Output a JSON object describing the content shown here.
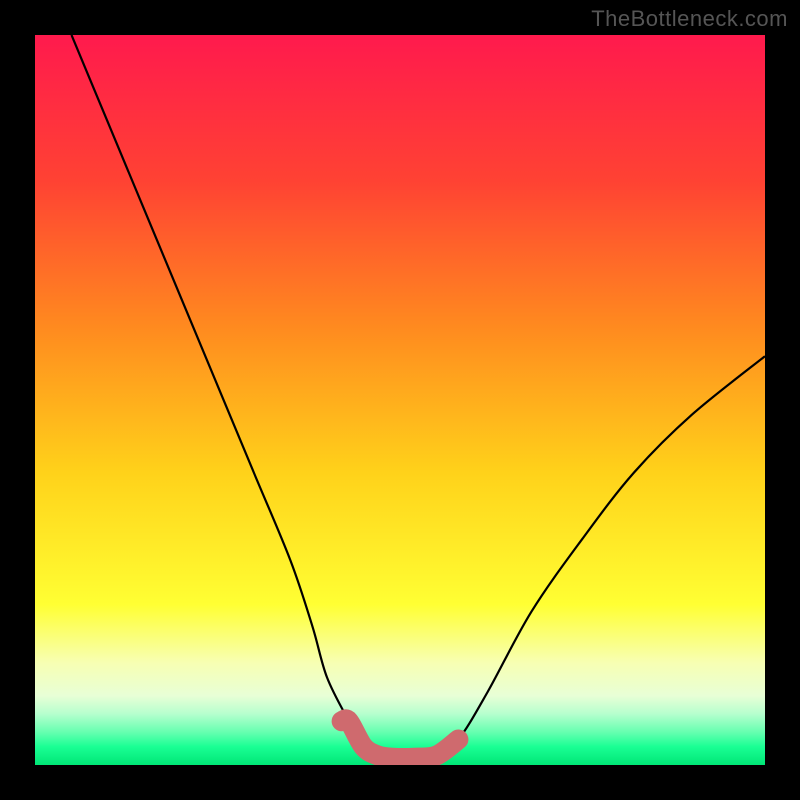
{
  "watermark": "TheBottleneck.com",
  "colors": {
    "frame": "#000000",
    "gradient_stops": [
      {
        "offset": 0.0,
        "color": "#ff1a4d"
      },
      {
        "offset": 0.2,
        "color": "#ff4233"
      },
      {
        "offset": 0.4,
        "color": "#ff8a1f"
      },
      {
        "offset": 0.6,
        "color": "#ffd21a"
      },
      {
        "offset": 0.78,
        "color": "#ffff33"
      },
      {
        "offset": 0.86,
        "color": "#f7ffb3"
      },
      {
        "offset": 0.905,
        "color": "#e8ffd6"
      },
      {
        "offset": 0.93,
        "color": "#b6ffce"
      },
      {
        "offset": 0.955,
        "color": "#66ffb0"
      },
      {
        "offset": 0.975,
        "color": "#1aff94"
      },
      {
        "offset": 1.0,
        "color": "#00e676"
      }
    ],
    "curve": "#000000",
    "highlight": "#cf6a6e"
  },
  "chart_data": {
    "type": "line",
    "title": "",
    "xlabel": "",
    "ylabel": "",
    "xlim": [
      0,
      100
    ],
    "ylim": [
      0,
      100
    ],
    "grid": false,
    "series": [
      {
        "name": "bottleneck-curve",
        "x": [
          5,
          10,
          15,
          20,
          25,
          30,
          35,
          38,
          40,
          43,
          45,
          47,
          49,
          52,
          55,
          58,
          62,
          68,
          75,
          82,
          90,
          100
        ],
        "values": [
          100,
          88,
          76,
          64,
          52,
          40,
          28,
          19,
          12,
          6,
          2.5,
          1.3,
          1.0,
          1.0,
          1.3,
          3.5,
          10,
          21,
          31,
          40,
          48,
          56
        ]
      }
    ],
    "annotations": [
      {
        "name": "highlight-segment",
        "x_start": 42,
        "x_end": 58,
        "style": "thick-rounded"
      }
    ]
  }
}
